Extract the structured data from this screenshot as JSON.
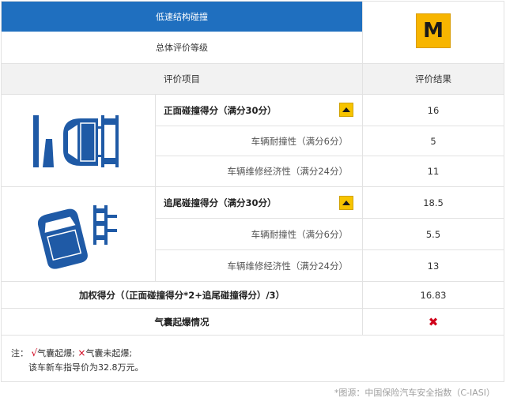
{
  "header": {
    "title": "低速结构碰撞",
    "grade_label": "总体评价等级",
    "grade_value": "M",
    "col_item": "评价项目",
    "col_result": "评价结果"
  },
  "sections": [
    {
      "icon": "front-collision-icon",
      "main_label": "正面碰撞得分（满分30分）",
      "main_value": "16",
      "sub": [
        {
          "label": "车辆耐撞性（满分6分）",
          "value": "5"
        },
        {
          "label": "车辆维修经济性（满分24分）",
          "value": "11"
        }
      ]
    },
    {
      "icon": "rear-collision-icon",
      "main_label": "追尾碰撞得分（满分30分）",
      "main_value": "18.5",
      "sub": [
        {
          "label": "车辆耐撞性（满分6分）",
          "value": "5.5"
        },
        {
          "label": "车辆维修经济性（满分24分）",
          "value": "13"
        }
      ]
    }
  ],
  "weighted": {
    "label": "加权得分（（正面碰撞得分*2+追尾碰撞得分）/3）",
    "value": "16.83"
  },
  "airbag": {
    "label": "气囊起爆情况",
    "value_icon": "cross-icon"
  },
  "notes": {
    "prefix": "注：",
    "check_symbol": "√",
    "deployed": "气囊起爆;",
    "cross_symbol": "×",
    "not_deployed": "气囊未起爆;",
    "price": "该车新车指导价为32.8万元。"
  },
  "source": "*图源：中国保险汽车安全指数（C-IASI）",
  "colors": {
    "header_blue": "#1f6fbf",
    "grade_orange": "#f7b500",
    "car_blue": "#1f5aa6",
    "red": "#d0021b"
  }
}
